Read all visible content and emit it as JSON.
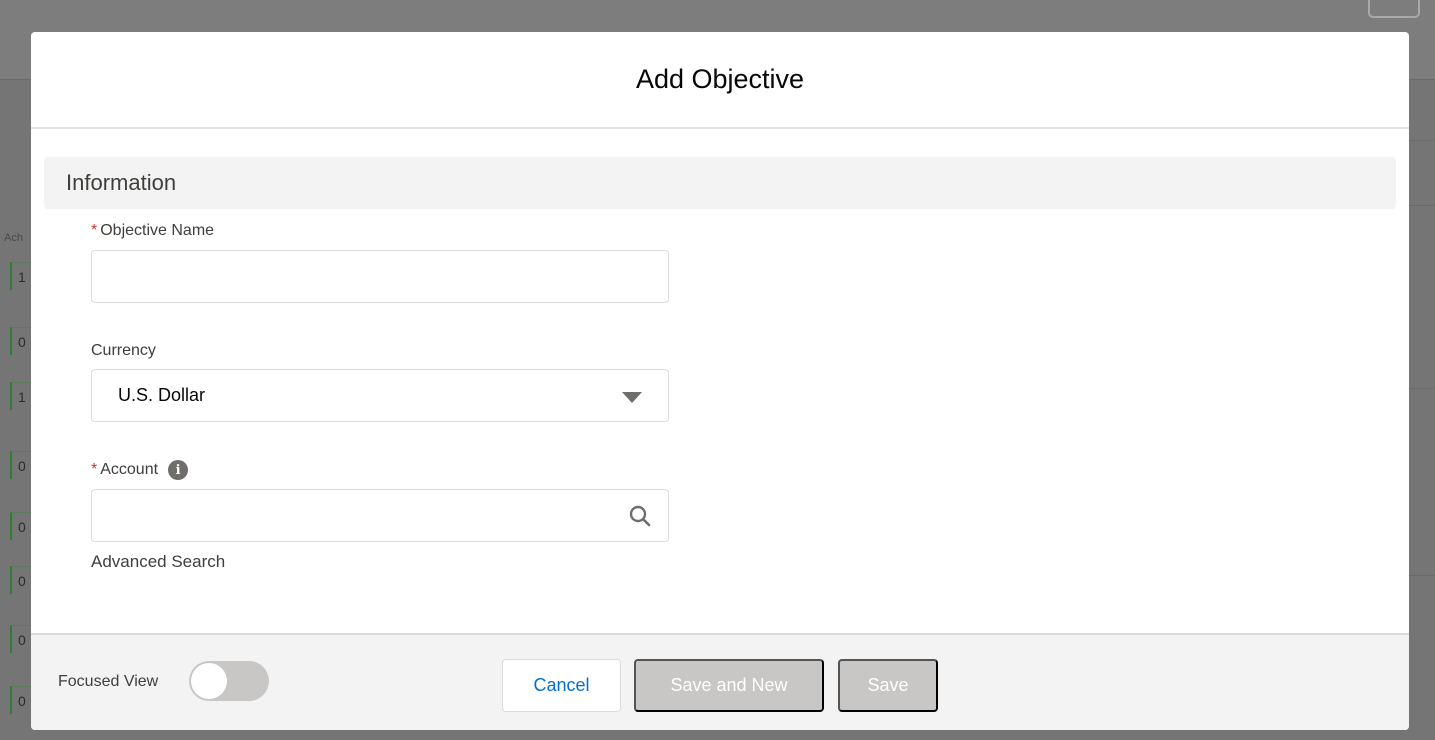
{
  "background": {
    "column_header": "Ach",
    "column_cells": [
      "1",
      "0",
      "1",
      "0",
      "0",
      "0",
      "0",
      "0"
    ]
  },
  "modal": {
    "title": "Add Objective",
    "section": "Information",
    "fields": {
      "objective_name": {
        "label": "Objective Name",
        "required_mark": "*",
        "value": ""
      },
      "currency": {
        "label": "Currency",
        "value": "U.S. Dollar"
      },
      "account": {
        "label": "Account",
        "required_mark": "*",
        "value": "",
        "info_icon_glyph": "i"
      }
    },
    "advanced_search": "Advanced Search",
    "footer": {
      "focused_view_label": "Focused View",
      "focused_view_on": false,
      "cancel": "Cancel",
      "save_and_new": "Save and New",
      "save": "Save"
    }
  },
  "colors": {
    "required": "#c23934",
    "link": "#0070d2",
    "disabled_button": "#c9c7c5"
  }
}
